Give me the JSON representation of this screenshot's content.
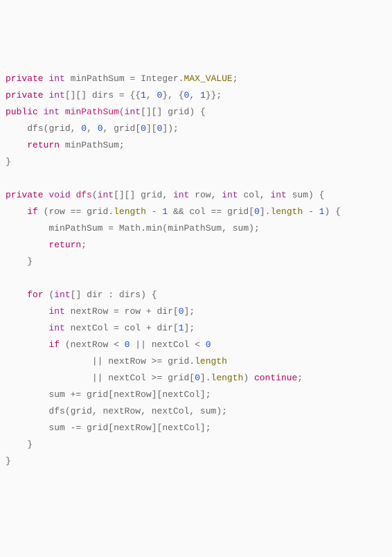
{
  "tok": {
    "kw_private": "private",
    "kw_public": "public",
    "kw_return": "return",
    "kw_void": "void",
    "kw_if": "if",
    "kw_for": "for",
    "kw_continue": "continue",
    "type_int": "int",
    "id_minPathSum": "minPathSum",
    "id_dirs": "dirs",
    "id_grid": "grid",
    "id_dfs": "dfs",
    "id_row": "row",
    "id_col": "col",
    "id_sum": "sum",
    "id_dir": "dir",
    "id_nextRow": "nextRow",
    "id_nextCol": "nextCol",
    "cls_Integer": "Integer",
    "cls_Math": "Math",
    "prop_MAX_VALUE": "MAX_VALUE",
    "prop_length": "length",
    "fn_min": "min",
    "lit_0": "0",
    "lit_1": "1"
  },
  "p": {
    "assign": " = ",
    "dot": ".",
    "semi": ";",
    "comma": ", ",
    "comma_nosp": ", ",
    "lparen": "(",
    "rparen": ")",
    "lbrace_sp": " {",
    "rbrace": "}",
    "lbrack": "[",
    "rbrack": "]",
    "arr2": "[][]",
    "arr1": "[]",
    "sp": " ",
    "dirs_init": " = {{",
    "dirs_mid": "}, {",
    "dirs_end": "}};",
    "eqeq": " == ",
    "and": " && ",
    "or": " || ",
    "or_lead_25": "                || ",
    "minus_one": " - ",
    "lt": " < ",
    "ge": " >= ",
    "plus": " + ",
    "pluseq": " += ",
    "minuseq": " -= ",
    "colon": " : ",
    "empty_line": " ",
    "rparen_sp": ") "
  }
}
